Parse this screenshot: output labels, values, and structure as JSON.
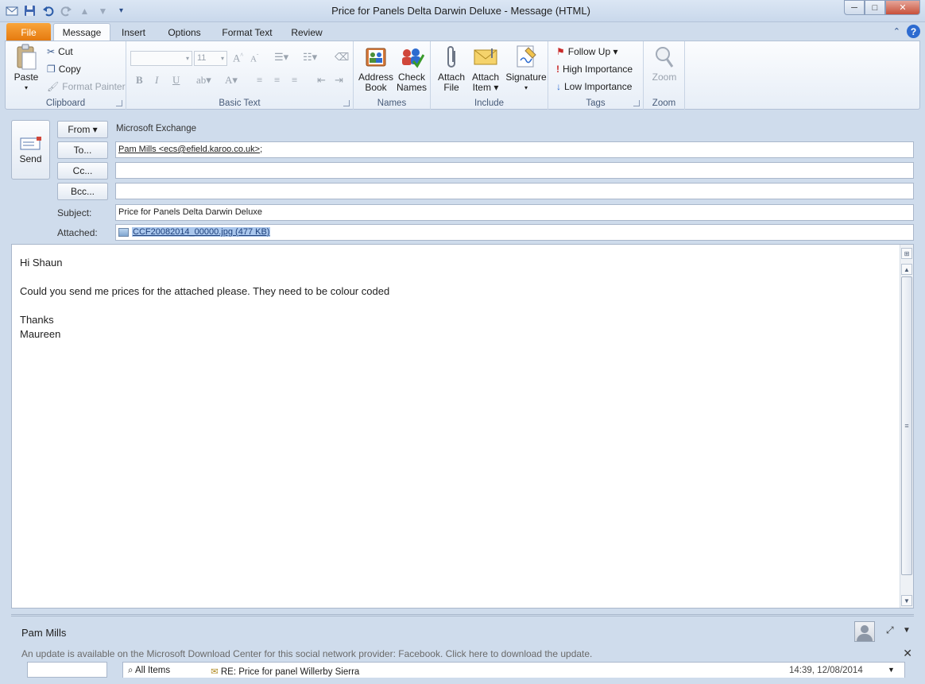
{
  "window": {
    "title": "Price for Panels  Delta Darwin Deluxe  -  Message (HTML)",
    "minimize": "─",
    "maximize": "□",
    "close": "✕"
  },
  "ribbon_tabs": [
    "File",
    "Message",
    "Insert",
    "Options",
    "Format Text",
    "Review"
  ],
  "clipboard": {
    "paste": "Paste",
    "cut": "Cut",
    "copy": "Copy",
    "format_painter": "Format Painter",
    "label": "Clipboard"
  },
  "basic_text": {
    "font_size": "11",
    "bold": "B",
    "italic": "I",
    "underline": "U",
    "label": "Basic Text"
  },
  "names": {
    "address_book_1": "Address",
    "address_book_2": "Book",
    "check_names_1": "Check",
    "check_names_2": "Names",
    "label": "Names"
  },
  "include": {
    "attach_file_1": "Attach",
    "attach_file_2": "File",
    "attach_item_1": "Attach",
    "attach_item_2": "Item ▾",
    "signature": "Signature",
    "signature_caret": "▾",
    "label": "Include"
  },
  "tags": {
    "follow_up": "Follow Up ▾",
    "high_importance": "High Importance",
    "low_importance": "Low Importance",
    "label": "Tags"
  },
  "zoom": {
    "zoom": "Zoom",
    "label": "Zoom"
  },
  "compose": {
    "send": "Send",
    "from_btn": "From ▾",
    "from_value": "Microsoft Exchange",
    "to_btn": "To...",
    "to_value": "Pam Mills <ecs@efield.karoo.co.uk>",
    "to_suffix": ";",
    "cc_btn": "Cc...",
    "bcc_btn": "Bcc...",
    "subject_label": "Subject:",
    "subject_value": "Price for Panels  Delta Darwin Deluxe",
    "attached_label": "Attached:",
    "attachment": "CCF20082014_00000.jpg (477 KB)"
  },
  "body": {
    "lines": [
      "Hi Shaun",
      "",
      "Could you send me prices for the attached please.  They need to be colour coded",
      "",
      "Thanks",
      "Maureen"
    ]
  },
  "people_pane": {
    "name": "Pam Mills",
    "update_notice": "An update is available on the Microsoft Download Center for this social network provider: Facebook. Click here to download the update.",
    "list_all_items": "All Items",
    "list_subject": "RE: Price for panel Willerby Sierra",
    "list_time": "14:39, 12/08/2014"
  }
}
